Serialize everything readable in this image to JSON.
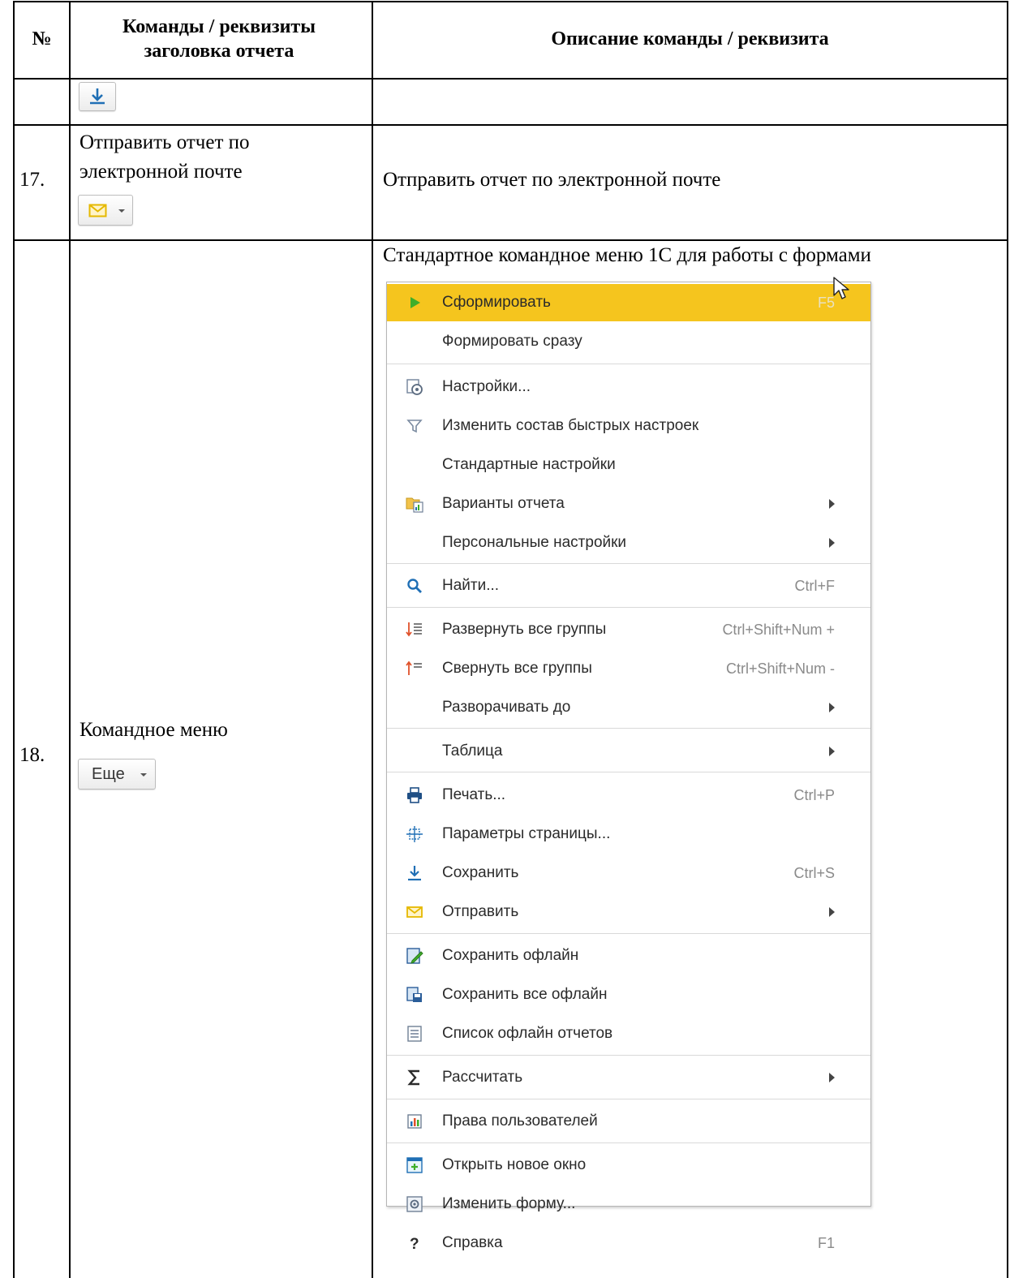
{
  "table": {
    "headers": {
      "num": "№",
      "commands": "Команды / реквизиты заголовка отчета",
      "description": "Описание команды / реквизита"
    },
    "rows": [
      {
        "num": "",
        "command": "",
        "description": ""
      },
      {
        "num": "17.",
        "command": "Отправить отчет по электронной почте",
        "description": "Отправить отчет по электронной почте"
      },
      {
        "num": "18.",
        "command": "Командное меню",
        "button_label": "Еще",
        "description": "Стандартное командное меню 1С для работы с формами"
      }
    ]
  },
  "menu": {
    "items": [
      {
        "label": "Сформировать",
        "shortcut": "F5",
        "icon": "play-icon",
        "active": true
      },
      {
        "label": "Формировать сразу",
        "shortcut": "",
        "icon": ""
      },
      {
        "label": "Настройки...",
        "shortcut": "",
        "icon": "settings-icon"
      },
      {
        "label": "Изменить состав быстрых настроек",
        "shortcut": "",
        "icon": "filter-icon"
      },
      {
        "label": "Стандартные настройки",
        "shortcut": "",
        "icon": ""
      },
      {
        "label": "Варианты отчета",
        "shortcut": "",
        "icon": "report-variants-icon",
        "submenu": true
      },
      {
        "label": "Персональные настройки",
        "shortcut": "",
        "icon": "",
        "submenu": true
      },
      {
        "label": "Найти...",
        "shortcut": "Ctrl+F",
        "icon": "search-icon"
      },
      {
        "label": "Развернуть все группы",
        "shortcut": "Ctrl+Shift+Num +",
        "icon": "expand-groups-icon"
      },
      {
        "label": "Свернуть все группы",
        "shortcut": "Ctrl+Shift+Num -",
        "icon": "collapse-groups-icon"
      },
      {
        "label": "Разворачивать до",
        "shortcut": "",
        "icon": "",
        "submenu": true
      },
      {
        "label": "Таблица",
        "shortcut": "",
        "icon": "",
        "submenu": true
      },
      {
        "label": "Печать...",
        "shortcut": "Ctrl+P",
        "icon": "print-icon"
      },
      {
        "label": "Параметры страницы...",
        "shortcut": "",
        "icon": "page-setup-icon"
      },
      {
        "label": "Сохранить",
        "shortcut": "Ctrl+S",
        "icon": "save-icon"
      },
      {
        "label": "Отправить",
        "shortcut": "",
        "icon": "envelope-icon",
        "submenu": true
      },
      {
        "label": "Сохранить офлайн",
        "shortcut": "",
        "icon": "save-offline-icon"
      },
      {
        "label": "Сохранить все офлайн",
        "shortcut": "",
        "icon": "save-all-offline-icon"
      },
      {
        "label": "Список офлайн отчетов",
        "shortcut": "",
        "icon": "offline-list-icon"
      },
      {
        "label": "Рассчитать",
        "shortcut": "",
        "icon": "sigma-icon",
        "submenu": true
      },
      {
        "label": "Права пользователей",
        "shortcut": "",
        "icon": "user-rights-icon"
      },
      {
        "label": "Открыть новое окно",
        "shortcut": "",
        "icon": "new-window-icon"
      },
      {
        "label": "Изменить форму...",
        "shortcut": "",
        "icon": "change-form-icon"
      },
      {
        "label": "Справка",
        "shortcut": "F1",
        "icon": "help-icon"
      }
    ]
  },
  "colors": {
    "highlight": "#f5c51e",
    "play": "#3fae2a",
    "accent_blue": "#1f6fb5",
    "accent_orange": "#e0522b",
    "envelope": "#e5b800"
  }
}
